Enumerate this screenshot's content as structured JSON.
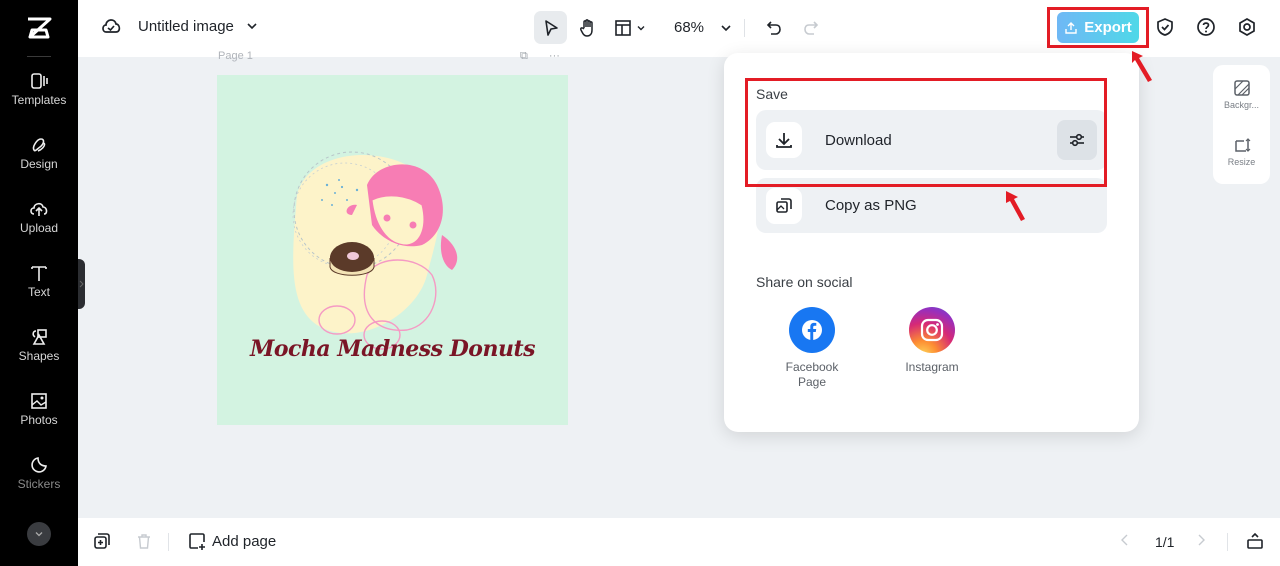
{
  "app": {
    "logo": "capcut-logo-icon"
  },
  "sidebar": {
    "items": [
      {
        "label": "Templates",
        "icon": "templates-icon"
      },
      {
        "label": "Design",
        "icon": "design-icon"
      },
      {
        "label": "Upload",
        "icon": "upload-cloud-icon"
      },
      {
        "label": "Text",
        "icon": "text-icon"
      },
      {
        "label": "Shapes",
        "icon": "shapes-icon"
      },
      {
        "label": "Photos",
        "icon": "photos-icon"
      },
      {
        "label": "Stickers",
        "icon": "stickers-icon"
      }
    ],
    "more_icon": "chevron-down-icon"
  },
  "header": {
    "file_title": "Untitled image",
    "zoom": "68%",
    "export_label": "Export",
    "tools": [
      "select-pointer-icon",
      "hand-pan-icon",
      "layout-icon"
    ],
    "right_icons": [
      "shield-check-icon",
      "help-icon",
      "settings-hex-icon"
    ]
  },
  "canvas": {
    "page_label": "Page 1",
    "artboard_text": "Mocha Madness Donuts",
    "artboard_bg": "#d3f3e1"
  },
  "right_panel": {
    "items": [
      {
        "label": "Backgr...",
        "icon": "background-icon"
      },
      {
        "label": "Resize",
        "icon": "resize-icon"
      }
    ]
  },
  "export_menu": {
    "save_heading": "Save",
    "download_label": "Download",
    "copy_label": "Copy as PNG",
    "share_heading": "Share on social",
    "social": [
      {
        "label": "Facebook Page",
        "color": "#1877f2"
      },
      {
        "label": "Instagram",
        "color": "#d62976"
      }
    ]
  },
  "bottom": {
    "add_page_label": "Add page",
    "page_indicator": "1/1"
  },
  "annotations": {
    "highlight_color": "#e31c25"
  }
}
